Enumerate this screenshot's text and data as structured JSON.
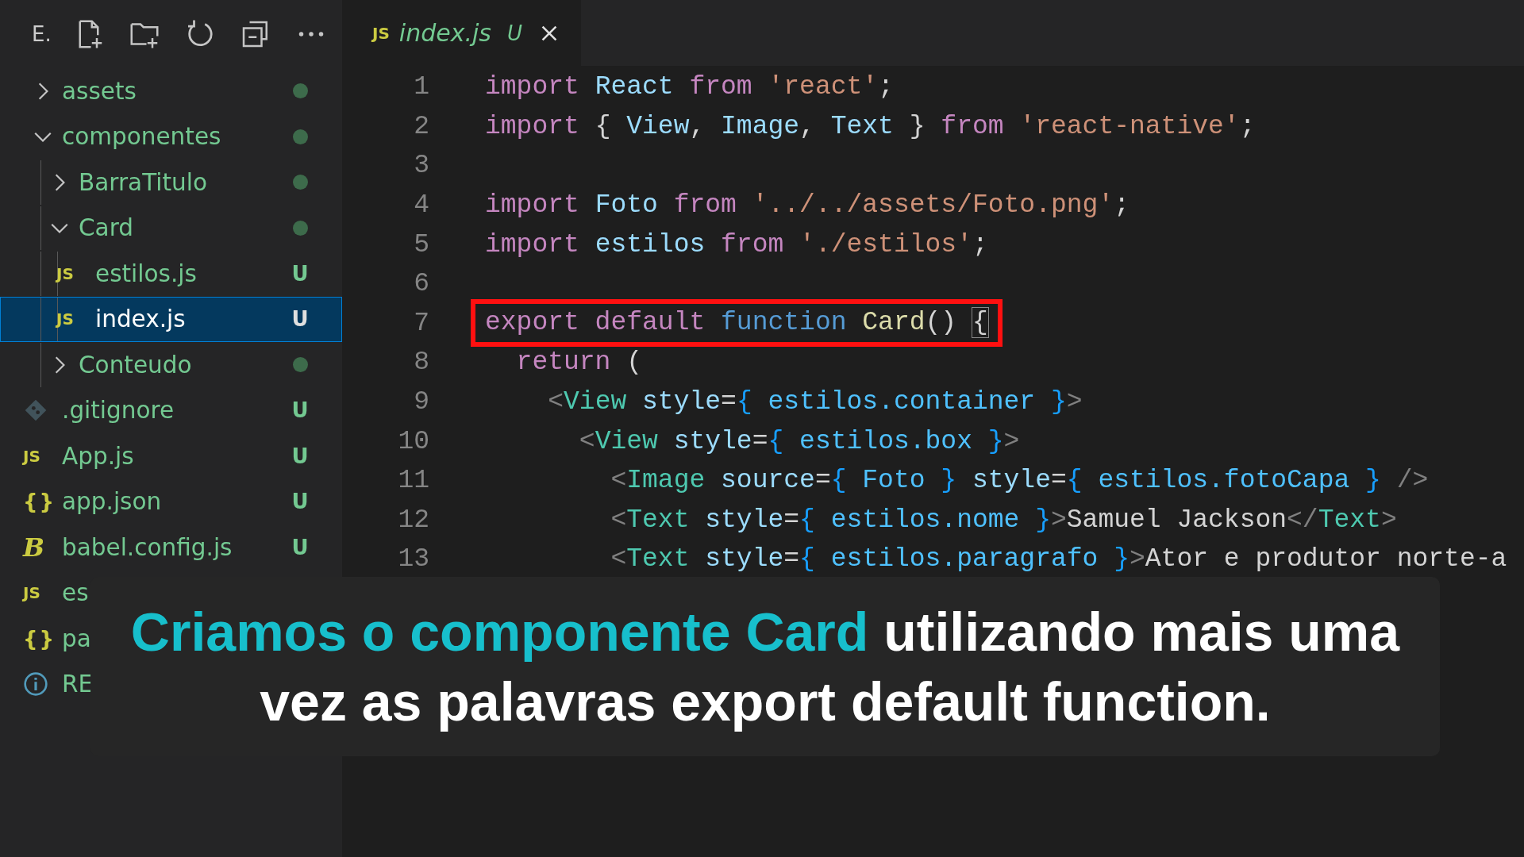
{
  "explorer": {
    "title": "E.",
    "tree": [
      {
        "name": "assets",
        "kind": "folder",
        "expanded": false,
        "modified": true
      },
      {
        "name": "componentes",
        "kind": "folder",
        "expanded": true,
        "modified": true,
        "children": [
          {
            "name": "BarraTitulo",
            "kind": "folder",
            "expanded": false,
            "modified": true
          },
          {
            "name": "Card",
            "kind": "folder",
            "expanded": true,
            "modified": true,
            "children": [
              {
                "name": "estilos.js",
                "kind": "js",
                "icon": "JS",
                "badge": "U",
                "selected": false
              },
              {
                "name": "index.js",
                "kind": "js",
                "icon": "JS",
                "badge": "U",
                "selected": true
              }
            ]
          },
          {
            "name": "Conteudo",
            "kind": "folder",
            "expanded": false,
            "modified": true
          }
        ]
      },
      {
        "name": ".gitignore",
        "kind": "git",
        "badge": "U",
        "selected": false
      },
      {
        "name": "App.js",
        "kind": "js",
        "icon": "JS",
        "badge": "U",
        "selected": false
      },
      {
        "name": "app.json",
        "kind": "json",
        "icon": "{}",
        "badge": "U",
        "selected": false
      },
      {
        "name": "babel.config.js",
        "kind": "babel",
        "icon": "B",
        "badge": "U",
        "selected": false
      },
      {
        "name": "es",
        "kind": "js",
        "icon": "JS",
        "selected": false
      },
      {
        "name": "pa",
        "kind": "json",
        "icon": "{}",
        "selected": false
      },
      {
        "name": "RE",
        "kind": "info",
        "selected": false
      }
    ]
  },
  "tabs": [
    {
      "icon": "JS",
      "label": "index.js",
      "badge": "U",
      "selected": true
    }
  ],
  "code": [
    {
      "number": "1",
      "tokens": [
        {
          "kind": "kw",
          "text": "import "
        },
        {
          "kind": "var",
          "text": "React "
        },
        {
          "kind": "kw",
          "text": "from "
        },
        {
          "kind": "str",
          "text": "'react'"
        },
        {
          "kind": "plain",
          "text": ";"
        }
      ]
    },
    {
      "number": "2",
      "tokens": [
        {
          "kind": "kw",
          "text": "import "
        },
        {
          "kind": "plain",
          "text": "{ "
        },
        {
          "kind": "var",
          "text": "View"
        },
        {
          "kind": "plain",
          "text": ", "
        },
        {
          "kind": "var",
          "text": "Image"
        },
        {
          "kind": "plain",
          "text": ", "
        },
        {
          "kind": "var",
          "text": "Text"
        },
        {
          "kind": "plain",
          "text": " } "
        },
        {
          "kind": "kw",
          "text": "from "
        },
        {
          "kind": "str",
          "text": "'react-native'"
        },
        {
          "kind": "plain",
          "text": ";"
        }
      ]
    },
    {
      "number": "3"
    },
    {
      "number": "4",
      "tokens": [
        {
          "kind": "kw",
          "text": "import "
        },
        {
          "kind": "var",
          "text": "Foto "
        },
        {
          "kind": "kw",
          "text": "from "
        },
        {
          "kind": "str",
          "text": "'../../assets/Foto.png'"
        },
        {
          "kind": "plain",
          "text": ";"
        }
      ]
    },
    {
      "number": "5",
      "tokens": [
        {
          "kind": "kw",
          "text": "import "
        },
        {
          "kind": "var",
          "text": "estilos "
        },
        {
          "kind": "kw",
          "text": "from "
        },
        {
          "kind": "str",
          "text": "'./estilos'"
        },
        {
          "kind": "plain",
          "text": ";"
        }
      ]
    },
    {
      "number": "6"
    },
    {
      "number": "7",
      "highlighted": true,
      "tokens": [
        {
          "kind": "kw",
          "text": "export default "
        },
        {
          "kind": "storage",
          "text": "function "
        },
        {
          "kind": "fn",
          "text": "Card"
        },
        {
          "kind": "plain",
          "text": "() "
        },
        {
          "kind": "match",
          "text": "{"
        }
      ]
    },
    {
      "number": "8",
      "tokens": [
        {
          "kind": "kw",
          "text": "  return"
        },
        {
          "kind": "plain",
          "text": " ("
        }
      ]
    },
    {
      "number": "9",
      "tokens": [
        {
          "kind": "punct",
          "text": "    <"
        },
        {
          "kind": "tag",
          "text": "View "
        },
        {
          "kind": "var",
          "text": "style"
        },
        {
          "kind": "plain",
          "text": "="
        },
        {
          "kind": "brace",
          "text": "{ "
        },
        {
          "kind": "prop",
          "text": "estilos.container "
        },
        {
          "kind": "brace",
          "text": "}"
        },
        {
          "kind": "punct",
          "text": ">"
        }
      ]
    },
    {
      "number": "10",
      "tokens": [
        {
          "kind": "punct",
          "text": "      <"
        },
        {
          "kind": "tag",
          "text": "View "
        },
        {
          "kind": "var",
          "text": "style"
        },
        {
          "kind": "plain",
          "text": "="
        },
        {
          "kind": "brace",
          "text": "{ "
        },
        {
          "kind": "prop",
          "text": "estilos.box "
        },
        {
          "kind": "brace",
          "text": "}"
        },
        {
          "kind": "punct",
          "text": ">"
        }
      ]
    },
    {
      "number": "11",
      "tokens": [
        {
          "kind": "punct",
          "text": "        <"
        },
        {
          "kind": "tag",
          "text": "Image "
        },
        {
          "kind": "var",
          "text": "source"
        },
        {
          "kind": "plain",
          "text": "="
        },
        {
          "kind": "brace",
          "text": "{ "
        },
        {
          "kind": "prop",
          "text": "Foto "
        },
        {
          "kind": "brace",
          "text": "} "
        },
        {
          "kind": "var",
          "text": "style"
        },
        {
          "kind": "plain",
          "text": "="
        },
        {
          "kind": "brace",
          "text": "{ "
        },
        {
          "kind": "prop",
          "text": "estilos.fotoCapa "
        },
        {
          "kind": "brace",
          "text": "} "
        },
        {
          "kind": "punct",
          "text": "/>"
        }
      ]
    },
    {
      "number": "12",
      "tokens": [
        {
          "kind": "punct",
          "text": "        <"
        },
        {
          "kind": "tag",
          "text": "Text "
        },
        {
          "kind": "var",
          "text": "style"
        },
        {
          "kind": "plain",
          "text": "="
        },
        {
          "kind": "brace",
          "text": "{ "
        },
        {
          "kind": "prop",
          "text": "estilos.nome "
        },
        {
          "kind": "brace",
          "text": "}"
        },
        {
          "kind": "punct",
          "text": ">"
        },
        {
          "kind": "plain",
          "text": "Samuel Jackson"
        },
        {
          "kind": "punct",
          "text": "</"
        },
        {
          "kind": "tag",
          "text": "Text"
        },
        {
          "kind": "punct",
          "text": ">"
        }
      ]
    },
    {
      "number": "13",
      "tokens": [
        {
          "kind": "punct",
          "text": "        <"
        },
        {
          "kind": "tag",
          "text": "Text "
        },
        {
          "kind": "var",
          "text": "style"
        },
        {
          "kind": "plain",
          "text": "="
        },
        {
          "kind": "brace",
          "text": "{ "
        },
        {
          "kind": "prop",
          "text": "estilos.paragrafo "
        },
        {
          "kind": "brace",
          "text": "}"
        },
        {
          "kind": "punct",
          "text": ">"
        },
        {
          "kind": "plain",
          "text": "Ator e produtor norte-a"
        }
      ]
    }
  ],
  "caption": "**Criamos o componente Card** utilizando mais uma vez as palavras export default function."
}
